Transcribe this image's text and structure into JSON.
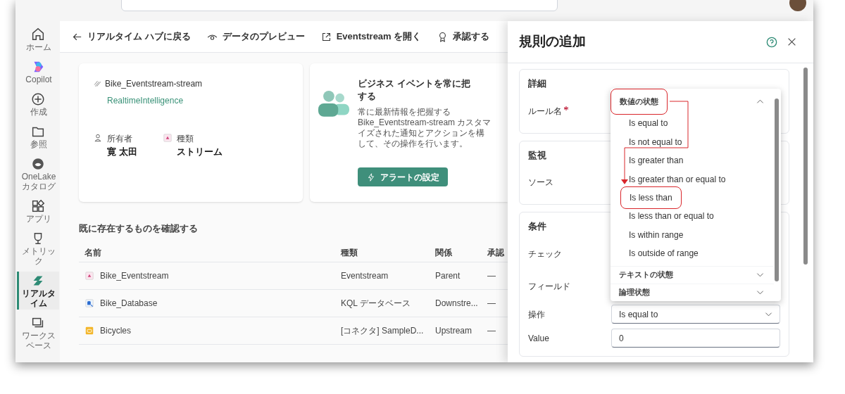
{
  "sidebar": {
    "items": [
      {
        "label": "ホーム",
        "selected": false
      },
      {
        "label": "Copilot",
        "selected": false
      },
      {
        "label": "作成",
        "selected": false
      },
      {
        "label": "参照",
        "selected": false
      },
      {
        "label": "OneLake カタログ",
        "selected": false
      },
      {
        "label": "アプリ",
        "selected": false
      },
      {
        "label": "メトリック",
        "selected": false
      },
      {
        "label": "リアルタイム",
        "selected": true
      },
      {
        "label": "ワークスペース",
        "selected": false
      }
    ]
  },
  "toolbar": [
    {
      "label": "リアルタイム ハブに戻る"
    },
    {
      "label": "データのプレビュー"
    },
    {
      "label": "Eventstream を開く"
    },
    {
      "label": "承認する"
    }
  ],
  "stream_card": {
    "name": "Bike_Eventstream-stream",
    "workspace": "RealtimeIntelligence",
    "owner_label": "所有者",
    "owner": "寛 太田",
    "type_label": "種類",
    "type": "ストリーム"
  },
  "alert_card": {
    "title_lines": [
      "ビジネス イベントを常に把",
      "する"
    ],
    "description_lines": [
      "常に最新情報を把握する",
      "Bike_Eventstream-stream カスタマ",
      "イズされた通知とアクションを構",
      "して、その操作を行います。"
    ],
    "button": "アラートの設定"
  },
  "related": {
    "title": "既に存在するものを確認する",
    "columns": [
      "名前",
      "種類",
      "関係",
      "承認"
    ],
    "rows": [
      {
        "name": "Bike_Eventstream",
        "type": "Eventstream",
        "relation": "Parent",
        "endorsement": "—"
      },
      {
        "name": "Bike_Database",
        "type": "KQL データベース",
        "relation": "Downstre...",
        "endorsement": "—"
      },
      {
        "name": "Bicycles",
        "type": "[コネクタ] SampleD...",
        "relation": "Upstream",
        "endorsement": "—"
      }
    ]
  },
  "panel": {
    "title": "規則の追加",
    "sections": [
      {
        "title": "詳細",
        "fields": [
          {
            "label": "ルール名",
            "required": true
          }
        ]
      },
      {
        "title": "監視",
        "fields": [
          {
            "label": "ソース",
            "required": false
          }
        ]
      },
      {
        "title": "条件",
        "fields": [
          {
            "label": "チェック",
            "required": false
          },
          {
            "label": "フィールド",
            "required": false
          },
          {
            "label": "操作",
            "required": false,
            "kind": "select",
            "value": "Is equal to"
          },
          {
            "label": "Value",
            "required": false,
            "kind": "input",
            "value": "0"
          }
        ]
      }
    ],
    "dropdown": {
      "groups": [
        {
          "label": "数値の状態",
          "expanded": true,
          "annotated": true,
          "options": [
            {
              "label": "Is equal to",
              "annotated": false
            },
            {
              "label": "Is not equal to",
              "annotated": false
            },
            {
              "label": "Is greater than",
              "annotated": false
            },
            {
              "label": "Is greater than or equal to",
              "annotated": false
            },
            {
              "label": "Is less than",
              "annotated": true
            },
            {
              "label": "Is less than or equal to",
              "annotated": false
            },
            {
              "label": "Is within range",
              "annotated": false
            },
            {
              "label": "Is outside of range",
              "annotated": false
            }
          ]
        },
        {
          "label": "テキストの状態",
          "expanded": false,
          "annotated": false
        },
        {
          "label": "論理状態",
          "expanded": false,
          "annotated": false
        }
      ]
    }
  }
}
